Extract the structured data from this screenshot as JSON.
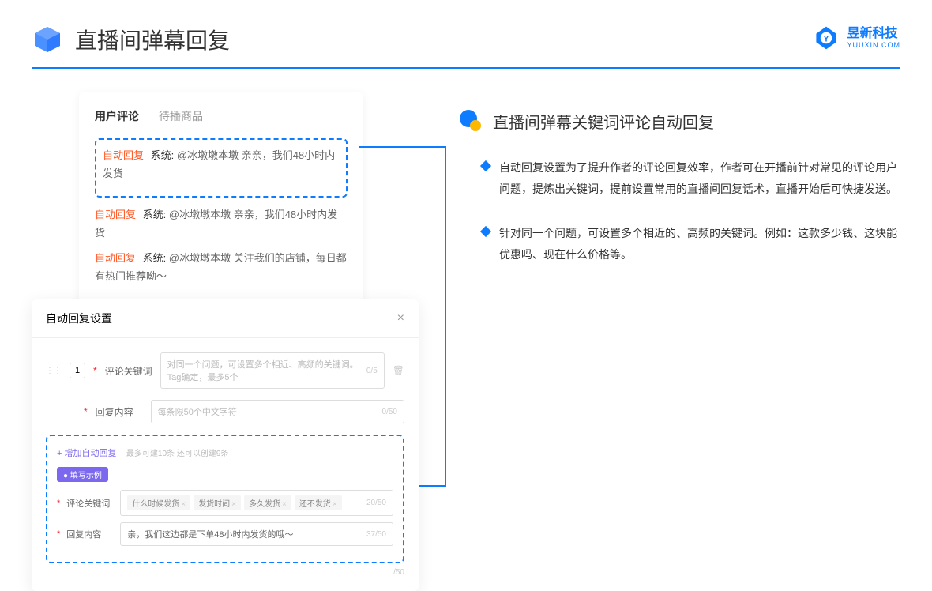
{
  "header": {
    "title": "直播间弹幕回复"
  },
  "logo": {
    "cn": "昱新科技",
    "en": "YUUXIN.COM"
  },
  "card": {
    "tab_active": "用户评论",
    "tab_inactive": "待播商品",
    "badge": "自动回复",
    "line1_sys": "系统:",
    "line1_text": "@冰墩墩本墩 亲亲，我们48小时内发货",
    "line2_text": "@冰墩墩本墩 亲亲，我们48小时内发货",
    "line3_text": "@冰墩墩本墩 关注我们的店铺，每日都有热门推荐呦～"
  },
  "settings": {
    "title": "自动回复设置",
    "row_num": "1",
    "label_keyword": "评论关键词",
    "placeholder_keyword": "对同一个问题，可设置多个相近、高频的关键词。Tag确定，最多5个",
    "count_keyword": "0/5",
    "label_content": "回复内容",
    "placeholder_content": "每条限50个中文字符",
    "count_content": "0/50",
    "add_link": "+ 增加自动回复",
    "add_hint": "最多可建10条 还可以创建9条",
    "example_badge": "● 填写示例",
    "ex_label_kw": "评论关键词",
    "tag1": "什么时候发货",
    "tag2": "发货时间",
    "tag3": "多久发货",
    "tag4": "还不发货",
    "ex_count_kw": "20/50",
    "ex_label_content": "回复内容",
    "ex_content": "亲，我们这边都是下单48小时内发货的哦～",
    "ex_count_content": "37/50",
    "outer_count": "/50"
  },
  "right": {
    "title": "直播间弹幕关键词评论自动回复",
    "bullet1": "自动回复设置为了提升作者的评论回复效率，作者可在开播前针对常见的评论用户问题，提炼出关键词，提前设置常用的直播间回复话术，直播开始后可快捷发送。",
    "bullet2": "针对同一个问题，可设置多个相近的、高频的关键词。例如：这款多少钱、这块能优惠吗、现在什么价格等。"
  }
}
